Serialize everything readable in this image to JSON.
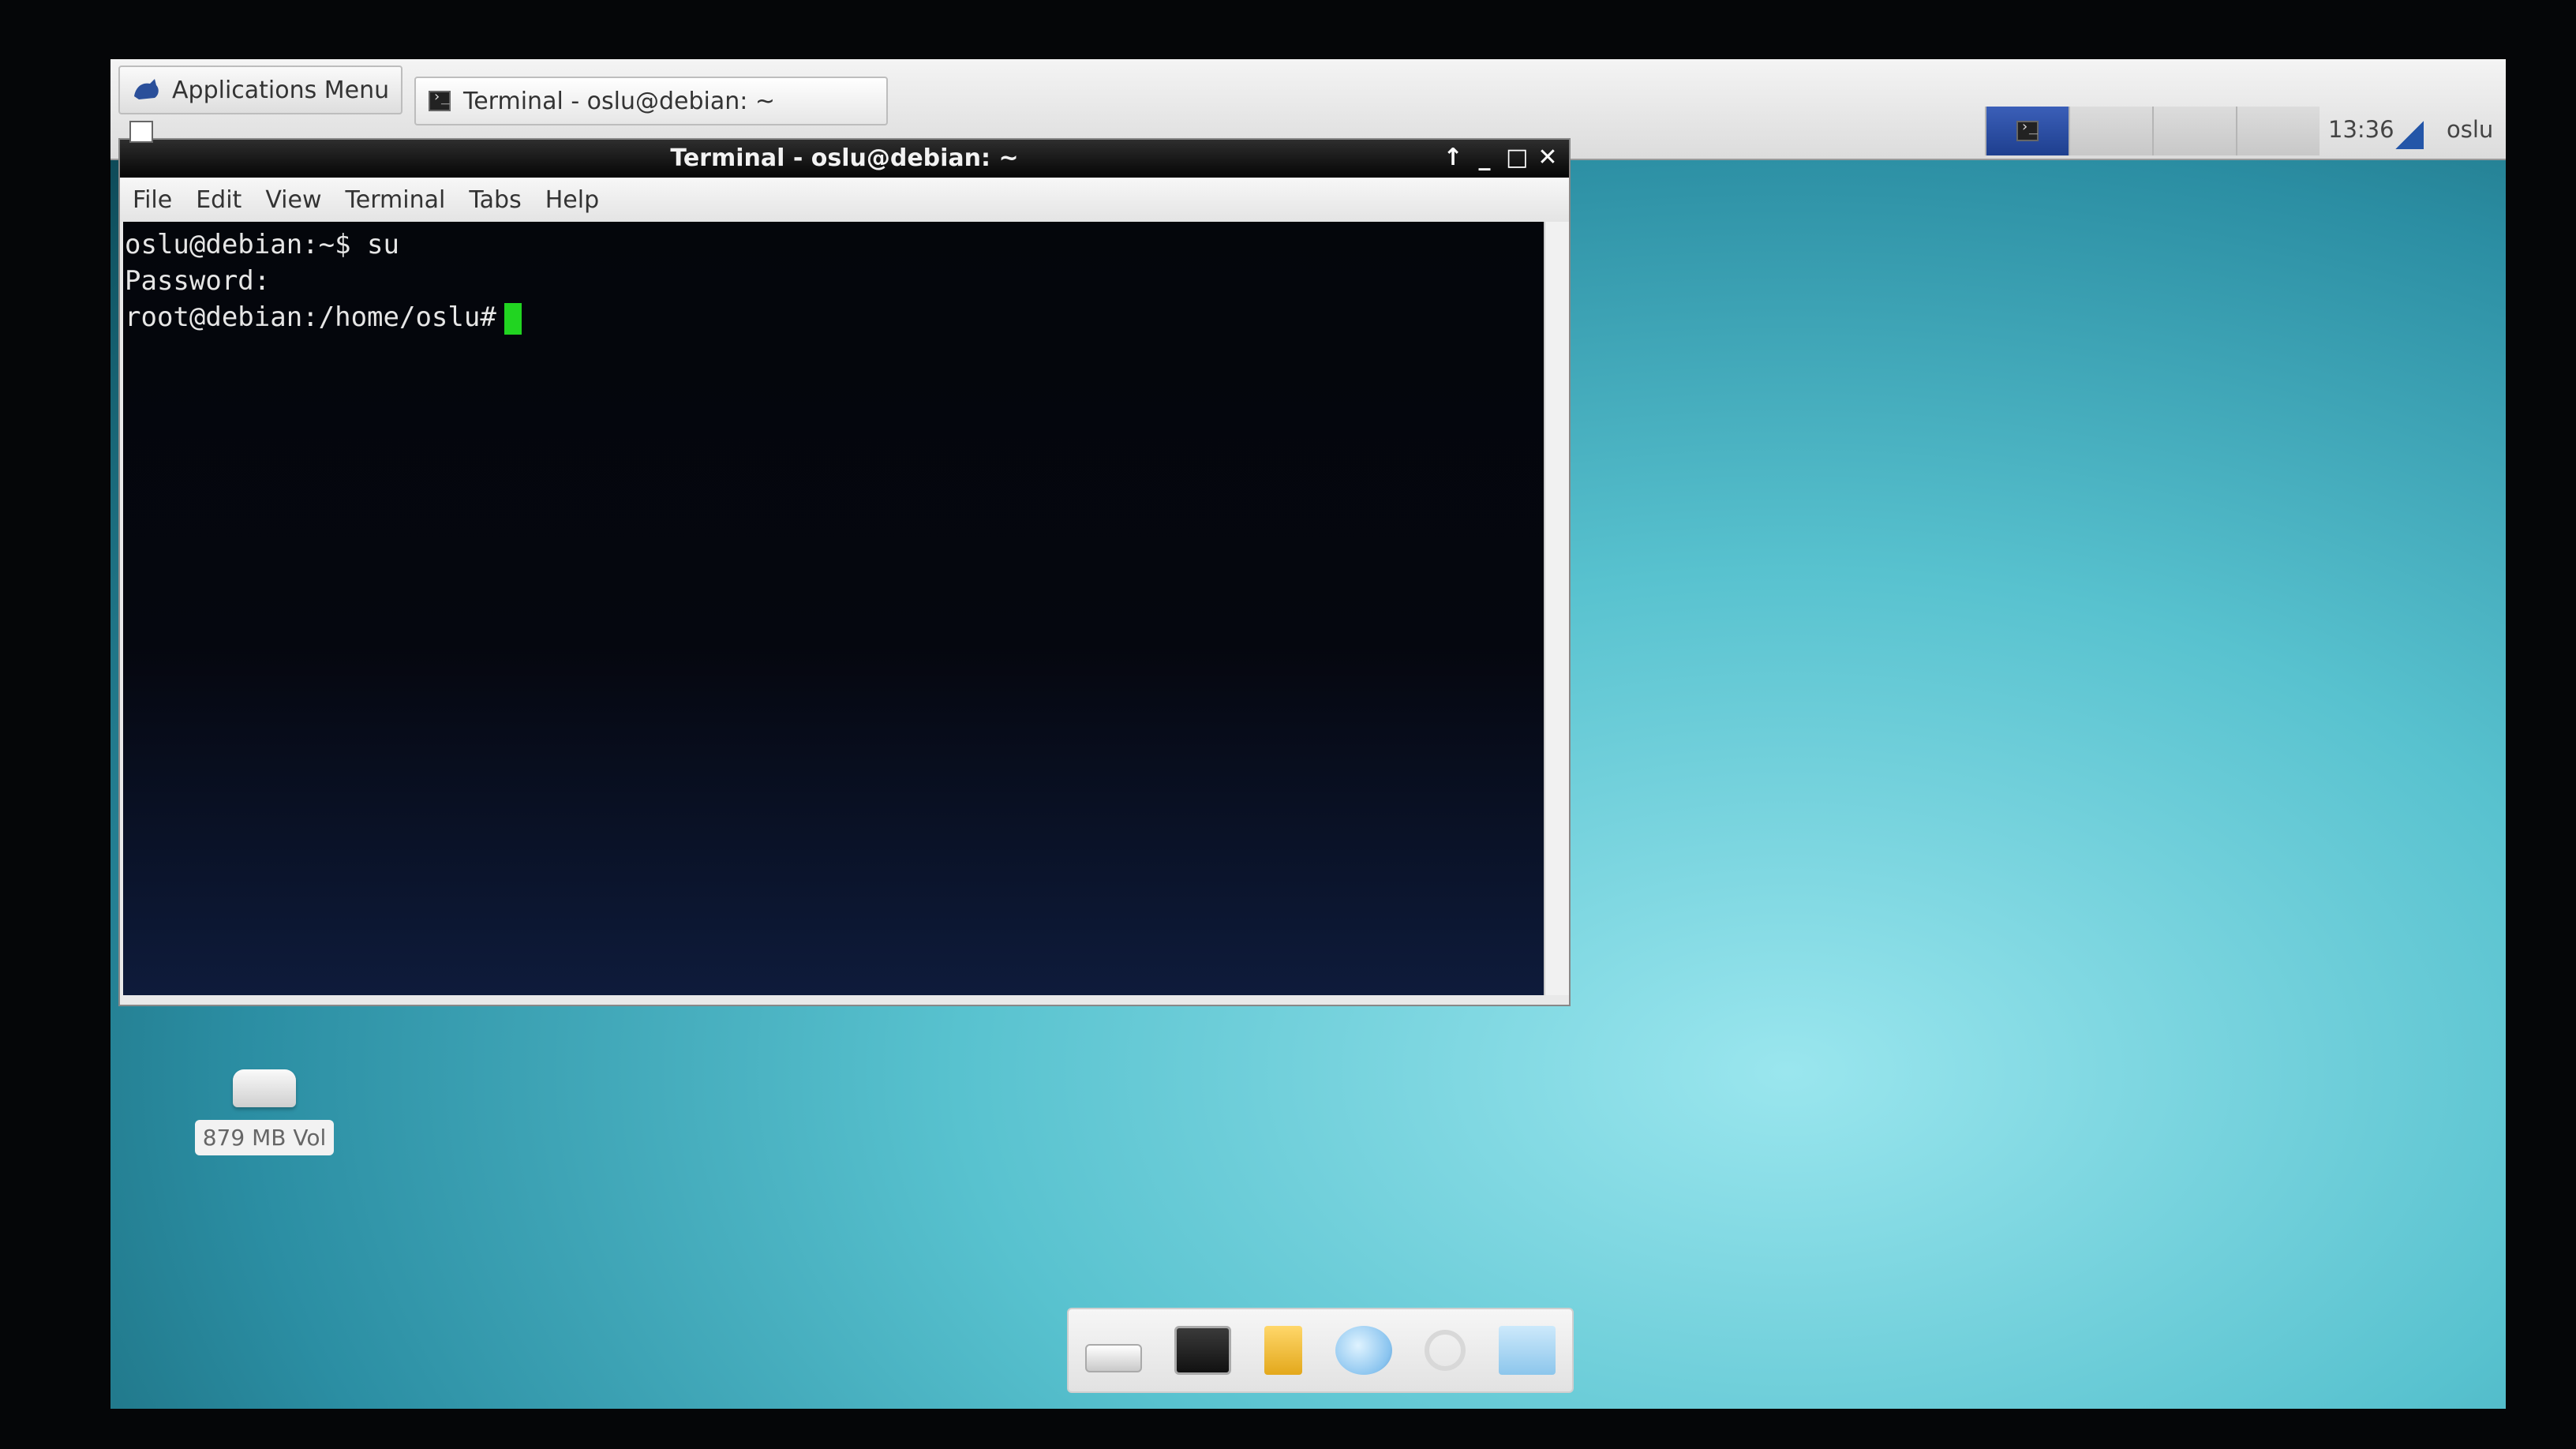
{
  "top_panel": {
    "applications_menu_label": "Applications Menu",
    "taskbar_item_label": "Terminal - oslu@debian: ~",
    "clock": "13:36",
    "user": "oslu"
  },
  "terminal_window": {
    "title": "Terminal - oslu@debian: ~",
    "menu": [
      "File",
      "Edit",
      "View",
      "Terminal",
      "Tabs",
      "Help"
    ],
    "lines": [
      "oslu@debian:~$ su",
      "Password:",
      "root@debian:/home/oslu#"
    ]
  },
  "desktop": {
    "icon_label": "879 MB Vol"
  },
  "colors": {
    "cursor": "#21d421",
    "terminal_bg": "#04060b",
    "desktop_accent": "#58c2cf"
  }
}
